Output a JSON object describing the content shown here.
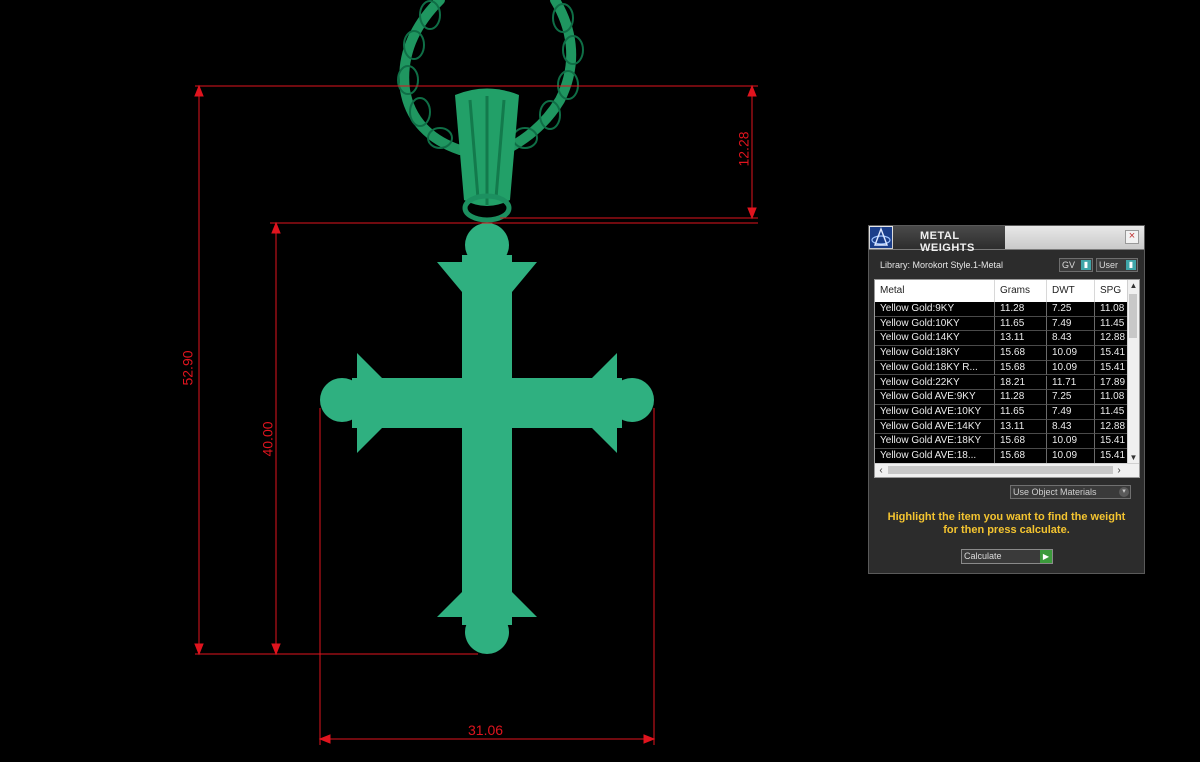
{
  "dimensions": {
    "overall_height": "52.90",
    "bail_height": "12.28",
    "cross_height": "40.00",
    "cross_width": "31.06"
  },
  "colors": {
    "background": "#000000",
    "model": "#2fb080",
    "chain": "#1f9660",
    "dimension_lines": "#e0141e",
    "hint_text": "#f4c430"
  },
  "panel": {
    "title": "METAL WEIGHTS",
    "close_icon": "×",
    "library_label": "Library: Morokort Style.1-Metal",
    "gv_select": "GV",
    "user_select": "User",
    "columns": [
      "Metal",
      "Grams",
      "DWT",
      "SPG"
    ],
    "rows": [
      [
        "Yellow Gold:9KY",
        "11.28",
        "7.25",
        "11.08"
      ],
      [
        "Yellow Gold:10KY",
        "11.65",
        "7.49",
        "11.45"
      ],
      [
        "Yellow Gold:14KY",
        "13.11",
        "8.43",
        "12.88"
      ],
      [
        "Yellow Gold:18KY",
        "15.68",
        "10.09",
        "15.41"
      ],
      [
        "Yellow Gold:18KY R...",
        "15.68",
        "10.09",
        "15.41"
      ],
      [
        "Yellow Gold:22KY",
        "18.21",
        "11.71",
        "17.89"
      ],
      [
        "Yellow Gold AVE:9KY",
        "11.28",
        "7.25",
        "11.08"
      ],
      [
        "Yellow Gold AVE:10KY",
        "11.65",
        "7.49",
        "11.45"
      ],
      [
        "Yellow Gold AVE:14KY",
        "13.11",
        "8.43",
        "12.88"
      ],
      [
        "Yellow Gold AVE:18KY",
        "15.68",
        "10.09",
        "15.41"
      ],
      [
        "Yellow Gold AVE:18...",
        "15.68",
        "10.09",
        "15.41"
      ]
    ],
    "material_select": "Use Object Materials",
    "hint": "Highlight the item you want to find the weight for then press calculate.",
    "calculate_select": "Calculate"
  }
}
